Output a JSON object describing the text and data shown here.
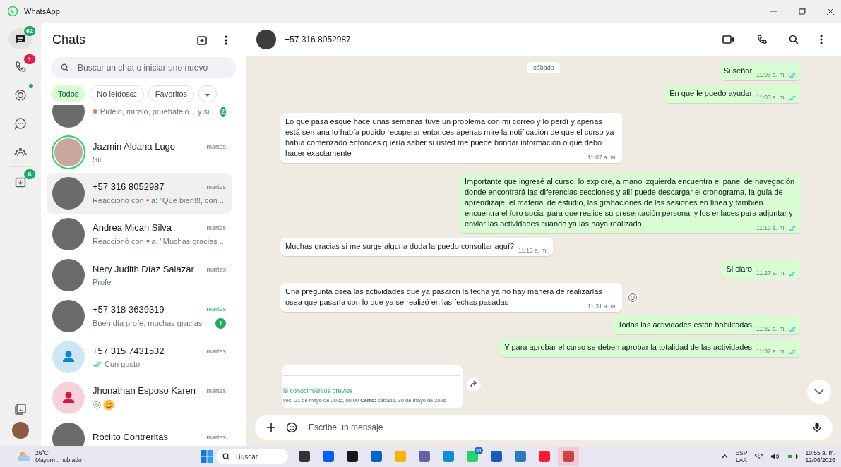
{
  "window": {
    "title": "WhatsApp"
  },
  "rail": {
    "items": [
      {
        "kind": "chats",
        "badge": "62",
        "selected": true
      },
      {
        "kind": "calls",
        "badge": "1",
        "selected": false
      },
      {
        "kind": "status",
        "dot": true,
        "selected": false
      },
      {
        "kind": "channels",
        "selected": false
      },
      {
        "kind": "communities",
        "selected": false
      },
      {
        "kind": "archived",
        "badge": "6",
        "selected": false
      }
    ]
  },
  "chat_list": {
    "title": "Chats",
    "search": {
      "placeholder": "Buscar un chat o iniciar uno nuevo"
    },
    "filters": [
      {
        "label": "Todos",
        "selected": true
      },
      {
        "label": "No leídos",
        "count": "62",
        "selected": false
      },
      {
        "label": "Favoritos",
        "selected": false
      }
    ],
    "chats": [
      {
        "kind": "photo",
        "preview": [
          {
            "kind": "package"
          },
          {
            "kind": "text",
            "text": "Pídelo, míralo, pruébatelo... y si ..."
          }
        ],
        "unread": "2",
        "selected": false
      },
      {
        "name": "Jazmin Aldana Lugo",
        "time": "martes",
        "kind": "photo",
        "story": true,
        "preview": [
          {
            "kind": "text",
            "text": "Siii"
          }
        ],
        "selected": false
      },
      {
        "name": "+57 316 8052987",
        "time": "martes",
        "kind": "photo",
        "preview": [
          {
            "kind": "text",
            "text": "Reaccionó con"
          },
          {
            "kind": "heart"
          },
          {
            "kind": "text",
            "text": "a: \"Que bien!!!, con ..."
          }
        ],
        "selected": true
      },
      {
        "name": "Andrea Mican Silva",
        "time": "martes",
        "kind": "photo",
        "preview": [
          {
            "kind": "text",
            "text": "Reaccionó con"
          },
          {
            "kind": "heart"
          },
          {
            "kind": "text",
            "text": "a: \"Muchas gracias ..."
          }
        ],
        "selected": false
      },
      {
        "name": "Nery Judith Díaz Salazar",
        "time": "martes",
        "kind": "photo",
        "preview": [
          {
            "kind": "text",
            "text": "Profe"
          }
        ],
        "selected": false
      },
      {
        "name": "+57 318 3639319",
        "time": "martes",
        "kind": "photo",
        "preview": [
          {
            "kind": "text",
            "text": "Buen día profe, muchas gracias"
          }
        ],
        "unread": "1",
        "selected": false
      },
      {
        "name": "+57 315 7431532",
        "time": "martes",
        "kind": "person",
        "color": "#0b87c4",
        "preview": [
          {
            "kind": "ticks"
          },
          {
            "kind": "text",
            "text": "Con gusto"
          }
        ],
        "selected": false
      },
      {
        "name": "Jhonathan Esposo Karen",
        "time": "martes",
        "kind": "person",
        "color": "#d5173f",
        "preview": [
          {
            "kind": "status"
          },
          {
            "kind": "smiley"
          }
        ],
        "selected": false
      },
      {
        "name": "Rociito Contreritas",
        "time": "martes",
        "kind": "photo",
        "selected": false
      }
    ]
  },
  "conversation": {
    "contact": "+57 316 8052987",
    "messages": [
      {
        "kind": "date",
        "text": "sábado"
      },
      {
        "kind": "out",
        "text": "Si señor",
        "time": "11:03 a. m.",
        "read": true
      },
      {
        "kind": "out",
        "text": "En que le puedo ayudar",
        "time": "11:03 a. m.",
        "read": true
      },
      {
        "kind": "in",
        "text": "Lo que pasa esque hace unas semanas tuve un problema con mi correo  y lo perdí y apenas está semana lo había podido recuperar entonces apenas mire la notificación de que el curso ya había comenzado entonces quería saber si usted me puede brindar información o que debo hacer  exactamente",
        "time": "11:07 a. m."
      },
      {
        "kind": "out",
        "text": "Importante que ingresé al curso, lo explore, a mano izquierda encuentra el panel de navegación donde encontrará las diferencias secciones y allí puede descargar el cronograma, la guía de aprendizaje, el material de estudio, las grabaciones de las sesiones en línea y también encuentra el foro social para que realice su presentación personal y los enlaces para adjuntar y enviar las actividades cuando ya las haya realizado",
        "time": "11:10 a. m.",
        "read": true
      },
      {
        "kind": "in",
        "text": "Muchas gracias si me surge alguna duda la puedo consultar aquí?",
        "time": "11:13 a. m."
      },
      {
        "kind": "out",
        "text": "Si claro",
        "time": "11:27 a. m.",
        "read": true
      },
      {
        "kind": "in",
        "text": "Una pregunta osea las actividades que ya pasaron la fecha ya no hay manera de realizarlas osea que pasaría con lo que ya se realizó en las fechas pasadas",
        "time": "11:31 a. m.",
        "react": true
      },
      {
        "kind": "out",
        "text": "Todas las actividades están habilitadas",
        "time": "11:32 a. m.",
        "read": true
      },
      {
        "kind": "out",
        "text": "Y para aprobar el curso se deben aprobar la totalidad de las actividades",
        "time": "11:32 a. m.",
        "read": true
      },
      {
        "kind": "card",
        "title": "le conocimientos previos",
        "meta": "ves, 21 de mayo de 2026, 00:00   **Cerró:** sábado, 30 de mayo de 2026"
      }
    ],
    "composer": {
      "placeholder": "Escribe un mensaje"
    }
  },
  "taskbar": {
    "weather": {
      "temp": "26°C",
      "desc": "Mayorm. nublado"
    },
    "search": "Buscar",
    "apps": [
      {
        "kind": "taskview"
      },
      {
        "kind": "dropbox"
      },
      {
        "kind": "amazon"
      },
      {
        "kind": "store"
      },
      {
        "kind": "folder"
      },
      {
        "kind": "teams"
      },
      {
        "kind": "edge"
      },
      {
        "kind": "whatsapp",
        "badge": "64"
      },
      {
        "kind": "word"
      },
      {
        "kind": "remote"
      },
      {
        "kind": "opera"
      },
      {
        "kind": "snip",
        "selected": true
      }
    ],
    "lang": "ESP",
    "layout": "LAA",
    "time": "10:55 a. m.",
    "date": "12/06/2026"
  }
}
